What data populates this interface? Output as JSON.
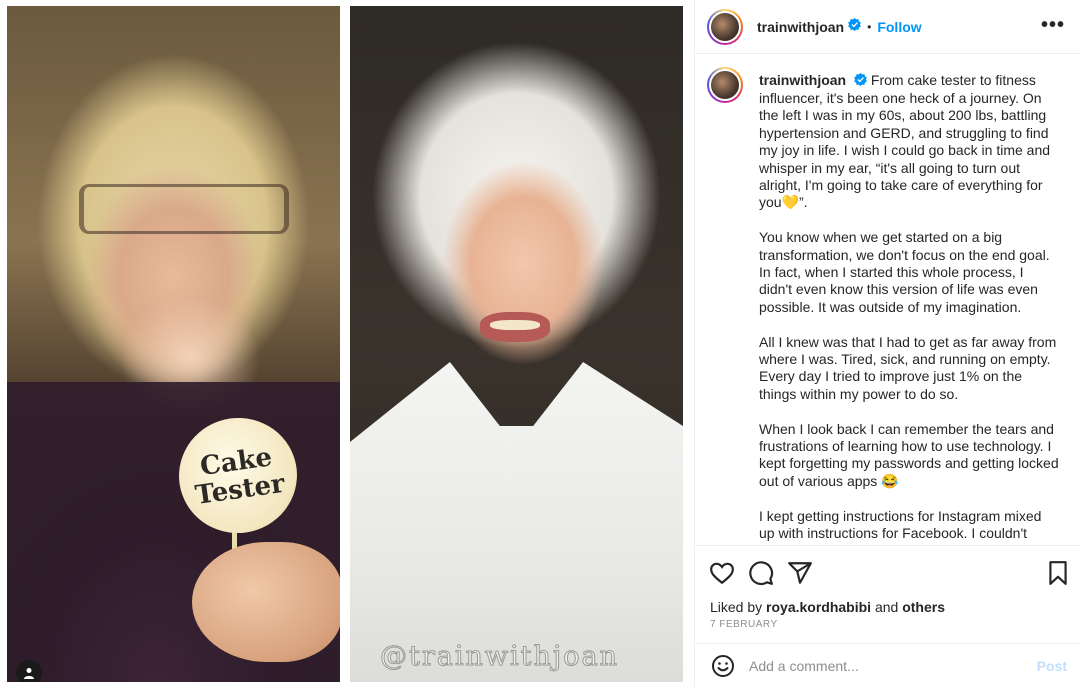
{
  "media": {
    "left_sign_text": [
      "Cake",
      "Tester"
    ],
    "watermark": "@trainwithjoan"
  },
  "header": {
    "username": "trainwithjoan",
    "separator": "•",
    "follow_label": "Follow",
    "more_label": "•••"
  },
  "caption": {
    "username": "trainwithjoan",
    "first_line": "From cake tester to fitness influencer, it's been one heck of a journey. On the left I was in my 60s, about 200 lbs, battling hypertension and GERD, and struggling to find my joy in life. I wish I could go back in time and whisper in my ear, “it's all going to turn out alright, I'm going to take care of everything for you💛”.",
    "paragraphs": [
      "You know when we get started on a big transformation, we don't focus on the end goal. In fact, when I started this whole process, I didn't even know this version of life was even possible. It was outside of my imagination.",
      "All I knew was that I had to get as far away from where I was. Tired, sick, and running on empty. Every day I tried to improve just 1% on the things within my power to do so.",
      "When I look back I can remember the tears and frustrations of learning how to use technology. I kept forgetting my passwords and getting locked out of various apps 😂",
      "I kept getting instructions for Instagram mixed up with instructions for Facebook. I couldn't"
    ]
  },
  "actions": {
    "icons": [
      "heart-icon",
      "comment-icon",
      "share-icon",
      "bookmark-icon"
    ]
  },
  "likes": {
    "prefix": "Liked by",
    "user": "roya.kordhabibi",
    "connector": "and",
    "others": "others"
  },
  "date": "7 February",
  "comment": {
    "placeholder": "Add a comment...",
    "post_label": "Post"
  },
  "colors": {
    "accent": "#0095f6",
    "post_disabled": "#c0dffd",
    "muted": "#8e8e8e"
  }
}
